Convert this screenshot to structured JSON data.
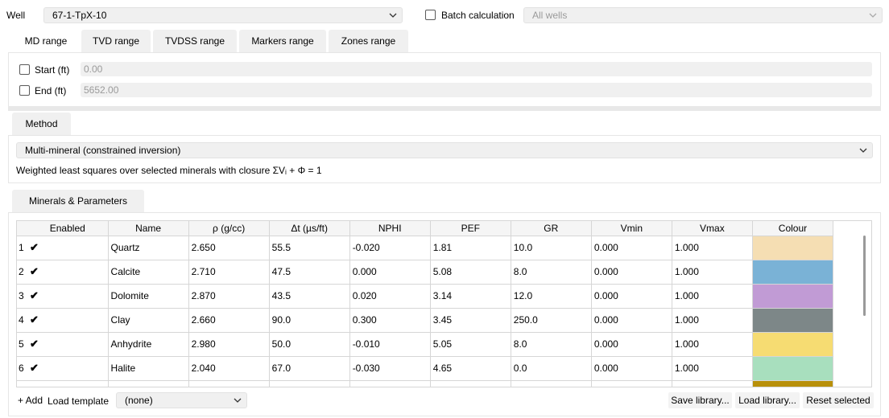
{
  "well": {
    "label": "Well",
    "value": "67-1-TpX-10"
  },
  "batch": {
    "label": "Batch calculation",
    "checked": false,
    "wells_value": "All wells"
  },
  "range_tabs": [
    {
      "label": "MD range",
      "active": true
    },
    {
      "label": "TVD range",
      "active": false
    },
    {
      "label": "TVDSS range",
      "active": false
    },
    {
      "label": "Markers range",
      "active": false
    },
    {
      "label": "Zones range",
      "active": false
    }
  ],
  "range": {
    "start": {
      "label": "Start (ft)",
      "value": "0.00"
    },
    "end": {
      "label": "End (ft)",
      "value": "5652.00"
    }
  },
  "method_tab": {
    "label": "Method"
  },
  "method": {
    "value": "Multi-mineral (constrained inversion)",
    "description": "Weighted least squares over selected minerals with closure ΣVᵢ + Φ = 1"
  },
  "minerals_tab": {
    "label": "Minerals & Parameters"
  },
  "table": {
    "columns": [
      "Enabled",
      "Name",
      "ρ (g/cc)",
      "Δt (µs/ft)",
      "NPHI",
      "PEF",
      "GR",
      "Vmin",
      "Vmax",
      "Colour"
    ],
    "rows": [
      {
        "num": "1",
        "enabled": "✔",
        "name": "Quartz",
        "rho": "2.650",
        "dt": "55.5",
        "nphi": "-0.020",
        "pef": "1.81",
        "gr": "10.0",
        "vmin": "0.000",
        "vmax": "1.000",
        "colour": "#f5deb3"
      },
      {
        "num": "2",
        "enabled": "✔",
        "name": "Calcite",
        "rho": "2.710",
        "dt": "47.5",
        "nphi": "0.000",
        "pef": "5.08",
        "gr": "8.0",
        "vmin": "0.000",
        "vmax": "1.000",
        "colour": "#7ab2d6"
      },
      {
        "num": "3",
        "enabled": "✔",
        "name": "Dolomite",
        "rho": "2.870",
        "dt": "43.5",
        "nphi": "0.020",
        "pef": "3.14",
        "gr": "12.0",
        "vmin": "0.000",
        "vmax": "1.000",
        "colour": "#c19bd5"
      },
      {
        "num": "4",
        "enabled": "✔",
        "name": "Clay",
        "rho": "2.660",
        "dt": "90.0",
        "nphi": "0.300",
        "pef": "3.45",
        "gr": "250.0",
        "vmin": "0.000",
        "vmax": "1.000",
        "colour": "#7d8788"
      },
      {
        "num": "5",
        "enabled": "✔",
        "name": "Anhydrite",
        "rho": "2.980",
        "dt": "50.0",
        "nphi": "-0.010",
        "pef": "5.05",
        "gr": "8.0",
        "vmin": "0.000",
        "vmax": "1.000",
        "colour": "#f6dc72"
      },
      {
        "num": "6",
        "enabled": "✔",
        "name": "Halite",
        "rho": "2.040",
        "dt": "67.0",
        "nphi": "-0.030",
        "pef": "4.65",
        "gr": "0.0",
        "vmin": "0.000",
        "vmax": "1.000",
        "colour": "#a8dfbe"
      }
    ],
    "partial_row_colour": "#b8900a"
  },
  "footer": {
    "add_label": "+ Add",
    "load_template_label": "Load template",
    "template_value": "(none)",
    "save_library_label": "Save library...",
    "load_library_label": "Load library...",
    "reset_selected_label": "Reset selected"
  }
}
